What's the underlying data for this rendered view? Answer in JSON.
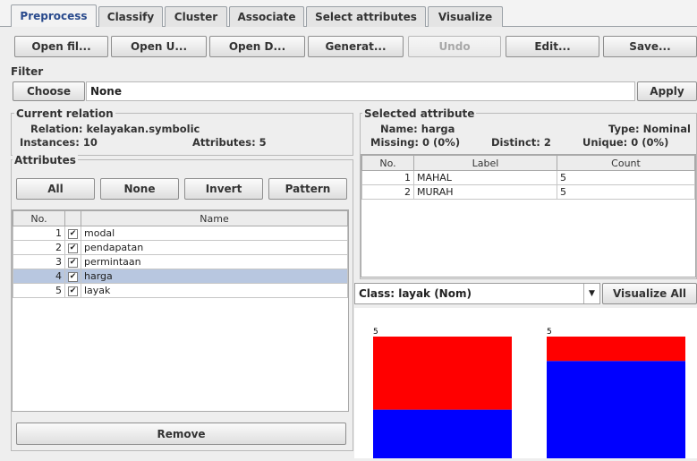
{
  "tabs": [
    {
      "label": "Preprocess",
      "active": true
    },
    {
      "label": "Classify"
    },
    {
      "label": "Cluster"
    },
    {
      "label": "Associate"
    },
    {
      "label": "Select attributes"
    },
    {
      "label": "Visualize"
    }
  ],
  "toolbar": {
    "open_file": "Open fil...",
    "open_url": "Open U...",
    "open_db": "Open D...",
    "generate": "Generat...",
    "undo": "Undo",
    "edit": "Edit...",
    "save": "Save..."
  },
  "filter": {
    "title": "Filter",
    "choose": "Choose",
    "value": "None",
    "apply": "Apply"
  },
  "current_relation": {
    "title": "Current relation",
    "relation": "Relation: kelayakan.symbolic",
    "instances": "Instances: 10",
    "attributes": "Attributes: 5"
  },
  "attributes_panel": {
    "title": "Attributes",
    "all": "All",
    "none": "None",
    "invert": "Invert",
    "pattern": "Pattern",
    "col_no": "No.",
    "col_name": "Name",
    "rows": [
      {
        "no": "1",
        "name": "modal",
        "checked": true
      },
      {
        "no": "2",
        "name": "pendapatan",
        "checked": true
      },
      {
        "no": "3",
        "name": "permintaan",
        "checked": true
      },
      {
        "no": "4",
        "name": "harga",
        "checked": true,
        "selected": true
      },
      {
        "no": "5",
        "name": "layak",
        "checked": true
      }
    ],
    "remove": "Remove"
  },
  "selected_attribute": {
    "title": "Selected attribute",
    "name": "Name: harga",
    "type": "Type: Nominal",
    "missing": "Missing: 0 (0%)",
    "distinct": "Distinct: 2",
    "unique": "Unique: 0 (0%)",
    "col_no": "No.",
    "col_label": "Label",
    "col_count": "Count",
    "rows": [
      {
        "no": "1",
        "label": "MAHAL",
        "count": "5"
      },
      {
        "no": "2",
        "label": "MURAH",
        "count": "5"
      }
    ]
  },
  "class_selector": {
    "value": "Class: layak (Nom)",
    "arrow": "▼",
    "visualize_all": "Visualize All"
  },
  "colors": {
    "red": "#ff0000",
    "blue": "#0000ff",
    "selection": "#b8c7e0"
  },
  "chart_data": {
    "type": "bar",
    "categories": [
      "MAHAL",
      "MURAH"
    ],
    "series": [
      {
        "values": [
          2,
          4
        ]
      },
      {
        "values": [
          3,
          1
        ]
      }
    ],
    "value_labels": [
      "5",
      "5"
    ]
  }
}
